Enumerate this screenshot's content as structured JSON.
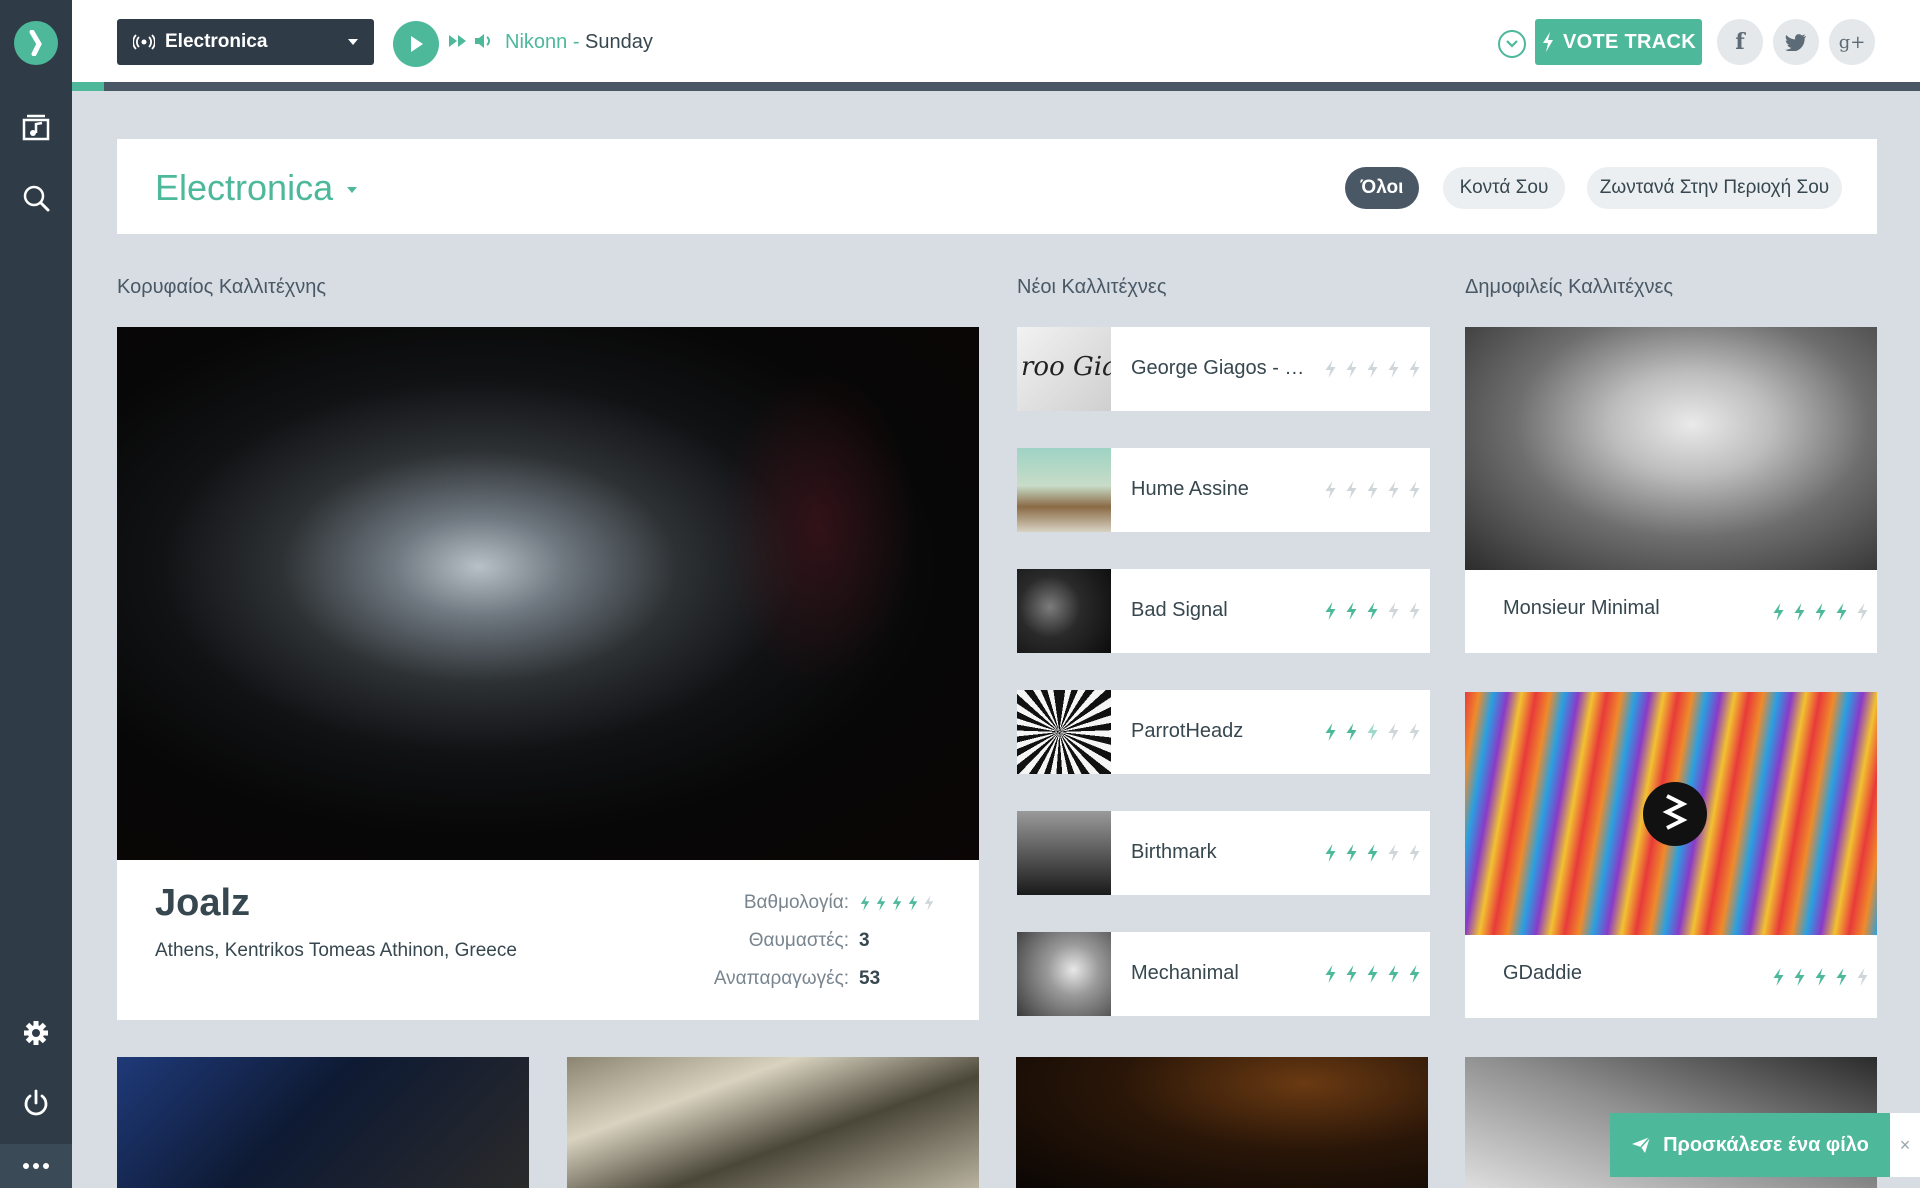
{
  "sidebar": {
    "logo_icon": "logo-icon",
    "items": [
      {
        "name": "music-library-icon"
      },
      {
        "name": "search-icon"
      },
      {
        "name": "settings-icon"
      },
      {
        "name": "power-icon"
      },
      {
        "name": "more-icon"
      }
    ]
  },
  "player": {
    "station_label": "Electronica",
    "artist": "Nikonn",
    "separator": " - ",
    "track": "Sunday",
    "vote_label": "VOTE TRACK"
  },
  "social": {
    "facebook": "f",
    "googleplus": "g+"
  },
  "header": {
    "genre": "Electronica",
    "filters": [
      "Όλοι",
      "Κοντά Σου",
      "Ζωντανά Στην Περιοχή Σου"
    ],
    "active_filter": "Όλοι"
  },
  "sections": {
    "featured": "Κορυφαίος Καλλιτέχνης",
    "new": "Νέοι Καλλιτέχνες",
    "popular": "Δημοφιλείς Καλλιτέχνες"
  },
  "featured": {
    "name": "Joalz",
    "location": "Athens, Kentrikos Tomeas Athinon, Greece",
    "rating_label": "Βαθμολογία:",
    "rating": 4,
    "fans_label": "Θαυμαστές:",
    "fans": "3",
    "plays_label": "Αναπαραγωγές:",
    "plays": "53"
  },
  "new_artists": [
    {
      "name": "George Giagos - D...",
      "rating": 0
    },
    {
      "name": "Hume Assine",
      "rating": 0
    },
    {
      "name": "Bad Signal",
      "rating": 3
    },
    {
      "name": "ParrotHeadz",
      "rating": 2.5
    },
    {
      "name": "Birthmark",
      "rating": 3
    },
    {
      "name": "Mechanimal",
      "rating": 5
    }
  ],
  "popular_artists": [
    {
      "name": "Monsieur Minimal",
      "rating": 4
    },
    {
      "name": "GDaddie",
      "rating": 4
    }
  ],
  "invite": {
    "label": "Προσκάλεσε ένα φίλο",
    "close": "×"
  },
  "colors": {
    "accent": "#4db89a",
    "sidebar": "#2f3c48",
    "background": "#d7dde2"
  }
}
